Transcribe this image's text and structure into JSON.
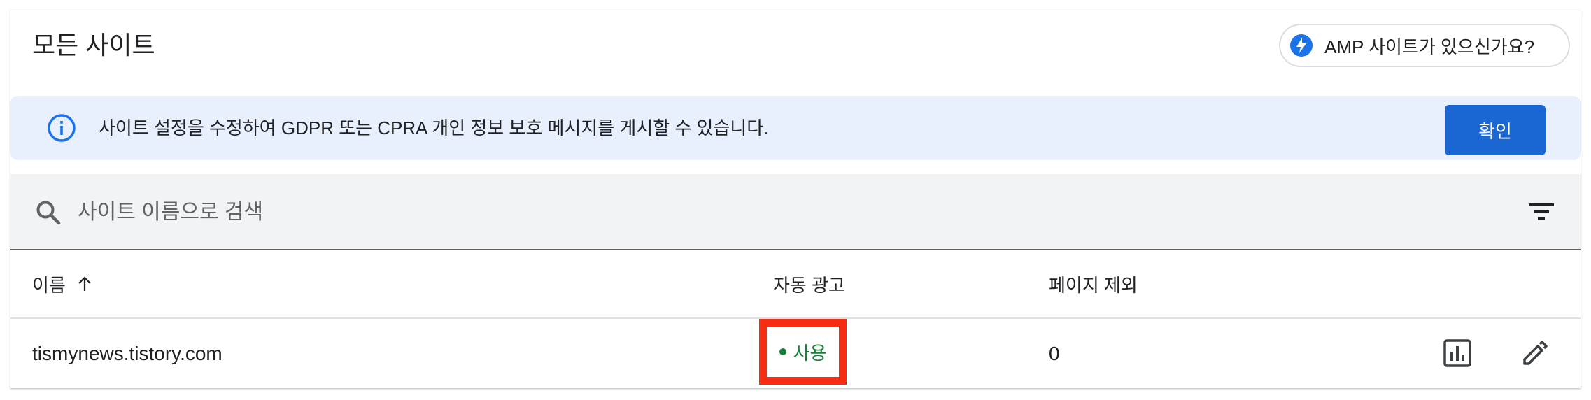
{
  "header": {
    "title": "모든 사이트",
    "amp_chip_label": "AMP 사이트가 있으신가요?"
  },
  "banner": {
    "message": "사이트 설정을 수정하여 GDPR 또는 CPRA 개인 정보 보호 메시지를 게시할 수 있습니다.",
    "confirm_label": "확인"
  },
  "search": {
    "placeholder": "사이트 이름으로 검색",
    "value": ""
  },
  "table": {
    "columns": {
      "name": "이름",
      "auto_ads": "자동 광고",
      "page_exclusions": "페이지 제외"
    },
    "sort": "ascending",
    "rows": [
      {
        "site": "tismynews.tistory.com",
        "auto_ads_status": "사용",
        "page_exclusions": "0"
      }
    ]
  },
  "colors": {
    "accent": "#1a73e8",
    "confirm_button": "#1a66d2",
    "banner_bg": "#e8f0fe",
    "status_green": "#188038",
    "highlight_red": "#f52d12"
  },
  "icons": {
    "amp": "lightning-bolt-icon",
    "info": "info-icon",
    "search": "search-icon",
    "filter": "filter-icon",
    "sort": "arrow-up-icon",
    "report": "bar-chart-icon",
    "edit": "pencil-icon"
  }
}
